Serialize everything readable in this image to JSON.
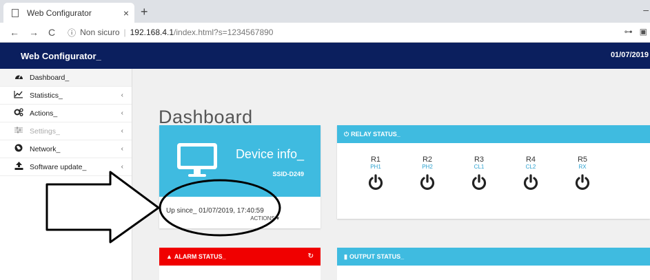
{
  "browser": {
    "tab_title": "Web Configurator",
    "tab_close": "×",
    "new_tab": "+",
    "minimize": "–",
    "security_label": "Non sicuro",
    "host": "192.168.4.1",
    "path": "/index.html?s=1234567890"
  },
  "header": {
    "brand": "Web Configurator_",
    "date": "01/07/2019"
  },
  "sidebar": {
    "items": [
      {
        "label": "Dashboard_",
        "icon": "dashboard-icon"
      },
      {
        "label": "Statistics_",
        "icon": "chart-icon",
        "chevron": "‹"
      },
      {
        "label": "Actions_",
        "icon": "gears-icon",
        "chevron": "‹"
      },
      {
        "label": "Settings_",
        "icon": "sliders-icon",
        "chevron": "‹"
      },
      {
        "label": "Network_",
        "icon": "globe-icon",
        "chevron": "‹"
      },
      {
        "label": "Software update_",
        "icon": "upload-icon",
        "chevron": "‹"
      }
    ]
  },
  "main": {
    "title": "Dashboard_",
    "device": {
      "title": "Device info_",
      "ssid": "SSID-D249",
      "up_since": "Up since_ 01/07/2019, 17:40:59",
      "actions": "ACTIONS ▾"
    },
    "relay": {
      "header": "RELAY STATUS_",
      "relays": [
        {
          "name": "R1",
          "tag": "PH1"
        },
        {
          "name": "R2",
          "tag": "PH2"
        },
        {
          "name": "R3",
          "tag": "CL1"
        },
        {
          "name": "R4",
          "tag": "CL2"
        },
        {
          "name": "R5",
          "tag": "RX"
        }
      ]
    },
    "alarm": {
      "header": "ALARM STATUS_"
    },
    "output": {
      "header": "OUTPUT STATUS_"
    }
  },
  "colors": {
    "navy": "#0b1f5e",
    "cyan": "#3fbbe0",
    "alarm_red": "#f00000"
  }
}
